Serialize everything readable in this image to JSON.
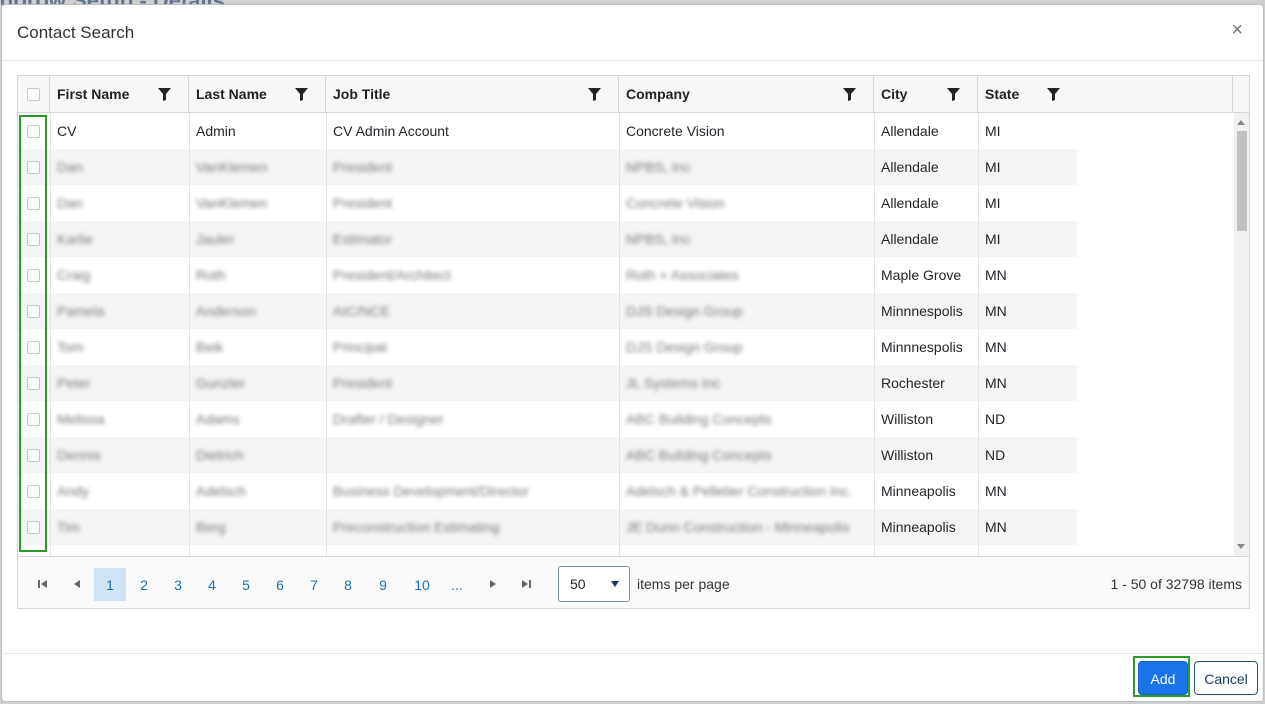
{
  "background": {
    "title": "dorow Setup - Details"
  },
  "modal": {
    "title": "Contact Search",
    "close_label": "×"
  },
  "columns": [
    {
      "label": "First Name"
    },
    {
      "label": "Last Name"
    },
    {
      "label": "Job Title"
    },
    {
      "label": "Company"
    },
    {
      "label": "City"
    },
    {
      "label": "State"
    }
  ],
  "rows": [
    {
      "first": "CV",
      "last": "Admin",
      "title": "CV Admin Account",
      "company": "Concrete Vision",
      "city": "Allendale",
      "state": "MI",
      "blurred": false
    },
    {
      "first": "Dan",
      "last": "VanKlemen",
      "title": "President",
      "company": "NPBS, Inc",
      "city": "Allendale",
      "state": "MI",
      "blurred": true
    },
    {
      "first": "Dan",
      "last": "VanKlemen",
      "title": "President",
      "company": "Concrete Vision",
      "city": "Allendale",
      "state": "MI",
      "blurred": true
    },
    {
      "first": "Karlie",
      "last": "Jauler",
      "title": "Estimator",
      "company": "NPBS, Inc",
      "city": "Allendale",
      "state": "MI",
      "blurred": true
    },
    {
      "first": "Craig",
      "last": "Roth",
      "title": "President/Architect",
      "company": "Roth + Associates",
      "city": "Maple Grove",
      "state": "MN",
      "blurred": true
    },
    {
      "first": "Pamela",
      "last": "Anderson",
      "title": "AIC/NCE",
      "company": "DJS Design Group",
      "city": "Minnnespolis",
      "state": "MN",
      "blurred": true
    },
    {
      "first": "Tom",
      "last": "Beik",
      "title": "Principal",
      "company": "DJS Design Group",
      "city": "Minnnespolis",
      "state": "MN",
      "blurred": true
    },
    {
      "first": "Peter",
      "last": "Gunzler",
      "title": "President",
      "company": "JL Systems Inc",
      "city": "Rochester",
      "state": "MN",
      "blurred": true
    },
    {
      "first": "Melissa",
      "last": "Adams",
      "title": "Drafter / Designer",
      "company": "ABC Building Concepts",
      "city": "Williston",
      "state": "ND",
      "blurred": true
    },
    {
      "first": "Dennis",
      "last": "Dietrich",
      "title": "",
      "company": "ABC Building Concepts",
      "city": "Williston",
      "state": "ND",
      "blurred": true
    },
    {
      "first": "Andy",
      "last": "Adelsch",
      "title": "Business Development/Director",
      "company": "Adelsch & Pelletier Construction Inc.",
      "city": "Minneapolis",
      "state": "MN",
      "blurred": true
    },
    {
      "first": "Tim",
      "last": "Berg",
      "title": "Preconstruction Estimating",
      "company": "JE Dunn Construction - Minneapolis",
      "city": "Minneapolis",
      "state": "MN",
      "blurred": true
    }
  ],
  "pager": {
    "pages": [
      "1",
      "2",
      "3",
      "4",
      "5",
      "6",
      "7",
      "8",
      "9",
      "10",
      "..."
    ],
    "current_page": "1",
    "per_page": "50",
    "per_page_label": "items per page",
    "range": "1 - 50 of 32798 items"
  },
  "buttons": {
    "add": "Add",
    "cancel": "Cancel"
  },
  "colors": {
    "primary": "#1a73e8",
    "highlight_frame": "#2e9a2e",
    "active_page": "#cfe3f5"
  }
}
